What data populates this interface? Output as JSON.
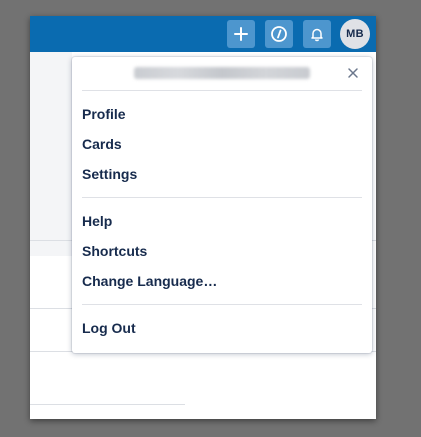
{
  "header": {
    "add_icon": "plus-icon",
    "info_icon": "info-icon",
    "notifications_icon": "bell-icon",
    "avatar_initials": "MB",
    "colors": {
      "header_bg": "#0a6bb0",
      "button_bg": "#4d96ce"
    }
  },
  "account_menu": {
    "account_label": "",
    "close_icon": "close-icon",
    "groups": [
      {
        "items": [
          {
            "label": "Profile"
          },
          {
            "label": "Cards"
          },
          {
            "label": "Settings"
          }
        ]
      },
      {
        "items": [
          {
            "label": "Help"
          },
          {
            "label": "Shortcuts"
          },
          {
            "label": "Change Language…"
          }
        ]
      },
      {
        "items": [
          {
            "label": "Log Out"
          }
        ]
      }
    ]
  }
}
